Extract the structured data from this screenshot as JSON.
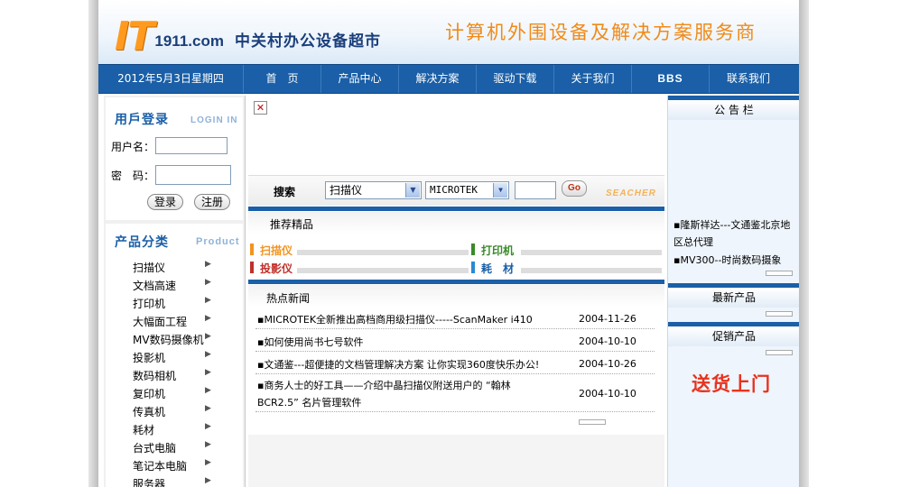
{
  "header": {
    "logo_it": "IT",
    "logo_domain": "1911.com",
    "logo_cn": "中关村办公设备超市",
    "slogan": "计算机外围设备及解决方案服务商"
  },
  "nav": {
    "date": "2012年5月3日星期四",
    "items": [
      "首　页",
      "产品中心",
      "解决方案",
      "驱动下载",
      "关于我们",
      "BBS",
      "联系我们"
    ]
  },
  "login": {
    "title": "用戶登录",
    "title_en": "LOGIN IN",
    "username_label": "用户名：",
    "password_label": "密　码：",
    "username_value": "",
    "password_value": "",
    "login_button": "登录",
    "register_button": "注册"
  },
  "categories": {
    "title": "产品分类",
    "title_en": "Product",
    "items": [
      "扫描仪",
      "文档高速",
      "打印机",
      "大幅面工程",
      "MV数码摄像机",
      "投影机",
      "数码相机",
      "复印机",
      "传真机",
      "耗材",
      "台式电脑",
      "笔记本电脑",
      "服务器"
    ]
  },
  "search": {
    "label": "搜索",
    "category_selected": "扫描仪",
    "brand_selected": "MICROTEK",
    "keyword_value": "",
    "go_button": "Go",
    "deco": "SEACHER"
  },
  "recommend": {
    "title": "推荐精品",
    "tags": [
      {
        "label": "扫描仪",
        "color": "#f29420"
      },
      {
        "label": "打印机",
        "color": "#3a8a2a"
      },
      {
        "label": "投影仪",
        "color": "#c0302a"
      },
      {
        "label": "耗　材",
        "color": "#2a8ad0"
      }
    ]
  },
  "hotnews": {
    "title": "热点新闻",
    "items": [
      {
        "title": "▪MICROTEK全新推出高档商用级扫描仪-----ScanMaker i410",
        "date": "2004-11-26"
      },
      {
        "title": "▪如何使用尚书七号软件",
        "date": "2004-10-10"
      },
      {
        "title": "▪文通鉴---超便捷的文档管理解决方案 让你实现360度快乐办公!",
        "date": "2004-10-26"
      },
      {
        "title": "▪商务人士的好工具——介绍中晶扫描仪附送用户的 “翰林",
        "title2": "BCR2.5” 名片管理软件",
        "date": "2004-10-10"
      }
    ]
  },
  "right": {
    "notice_title": "公 告 栏",
    "notices": [
      "隆斯祥达---文通鉴北京地区总代理",
      "MV300--时尚数码摄象"
    ],
    "new_products_title": "最新产品",
    "promo_title": "促销产品",
    "delivery": "送货上门"
  }
}
